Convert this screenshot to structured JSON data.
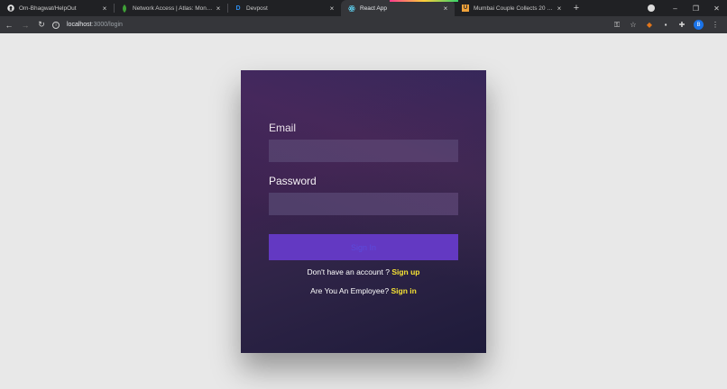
{
  "tabs": [
    {
      "icon": "github-icon",
      "title": "Om-Bhagwat/HelpOut",
      "active": false
    },
    {
      "icon": "mongodb-leaf-icon",
      "title": "Network Access | Atlas: MongoD...",
      "active": false
    },
    {
      "icon": "devpost-icon",
      "title": "Devpost",
      "active": false
    },
    {
      "icon": "react-icon",
      "title": "React App",
      "active": true
    },
    {
      "icon": "news-icon",
      "title": "Mumbai Couple Collects 20 Kg o...",
      "active": false
    }
  ],
  "address": {
    "host": "localhost",
    "path": ":3000/login"
  },
  "login": {
    "email_label": "Email",
    "email_value": "",
    "password_label": "Password",
    "password_value": "",
    "submit_label": "Sign In",
    "signup_prompt": "Don't have an account ?",
    "signup_link": "Sign up",
    "employee_prompt": "Are You An Employee?",
    "employee_link": "Sign in"
  },
  "profile": {
    "initial": "B"
  },
  "colors": {
    "accent_link": "#f5e134",
    "button": "#6339c2",
    "input_bg": "#4f3f6a",
    "page_bg": "#e8e8e8"
  }
}
